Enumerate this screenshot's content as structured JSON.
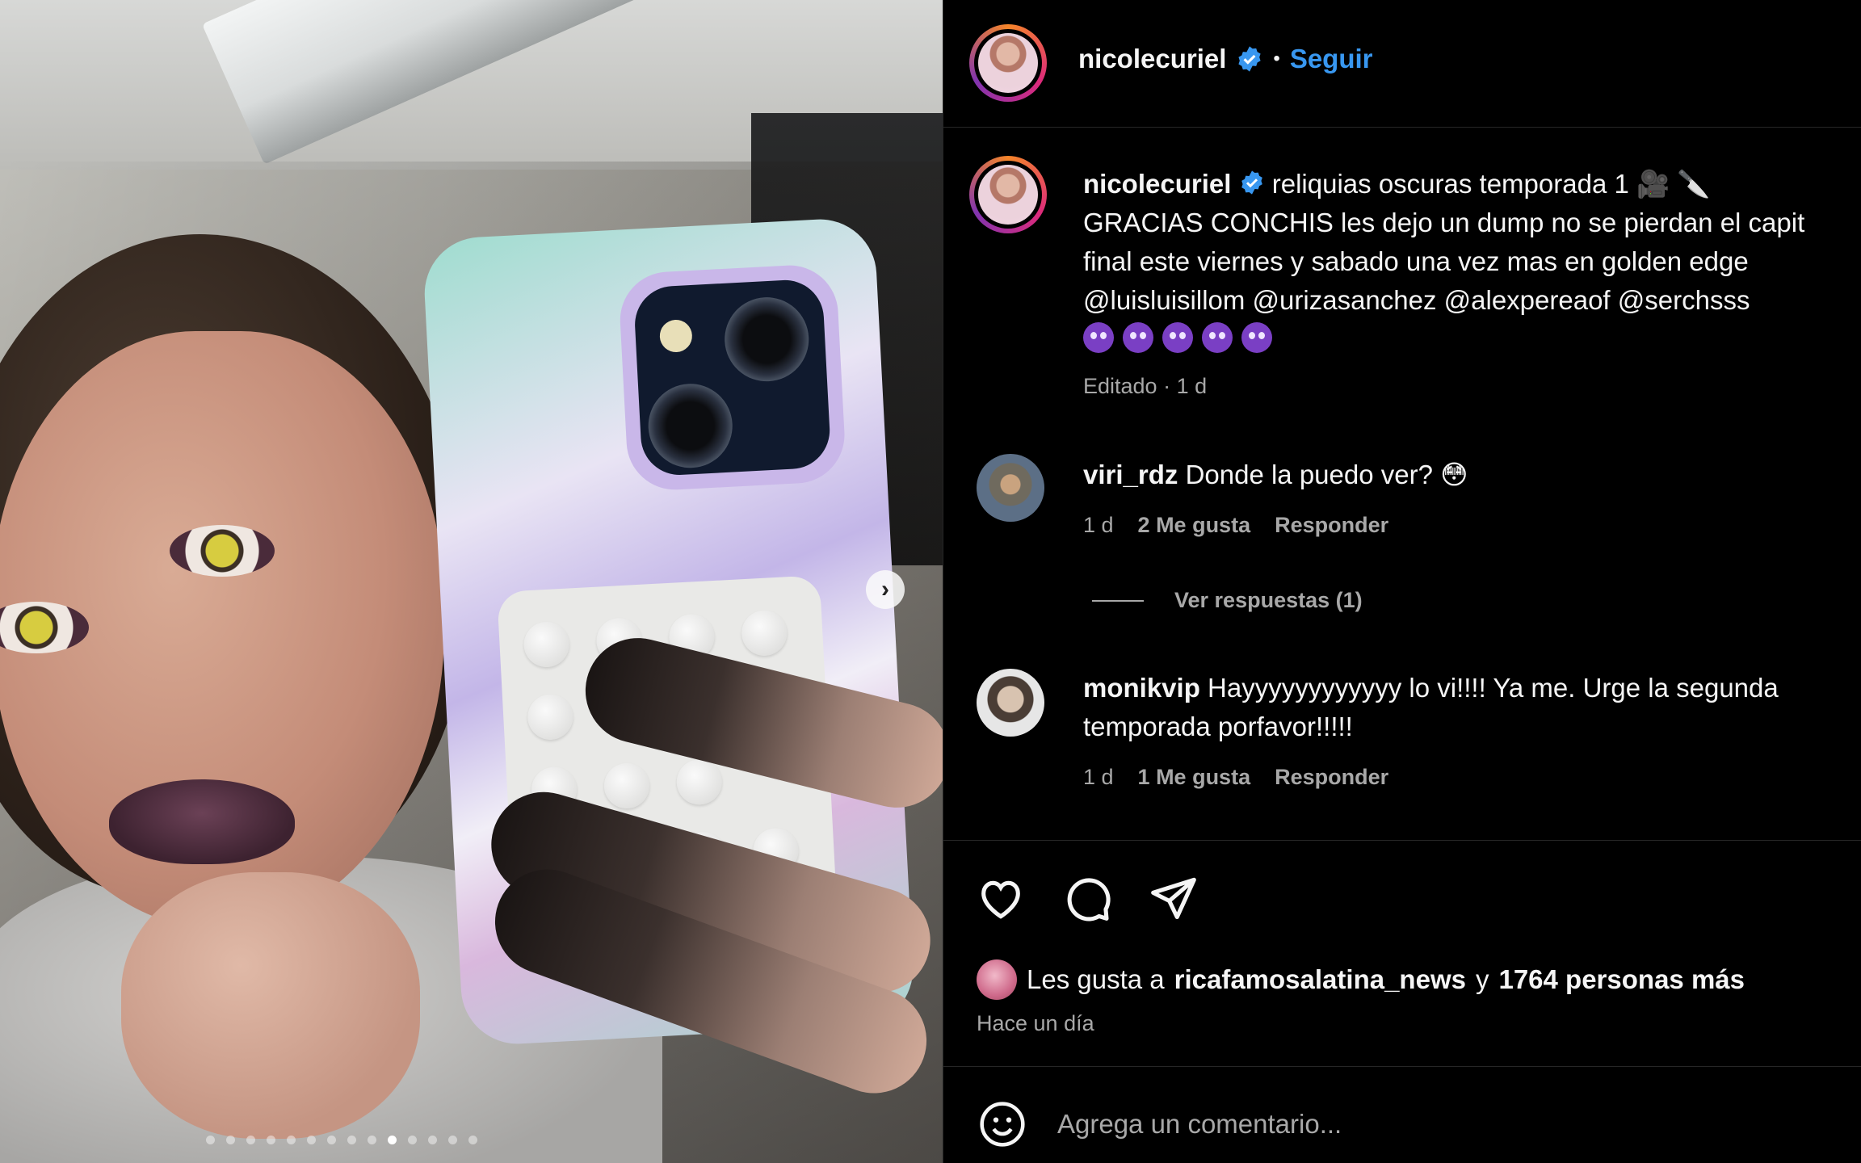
{
  "post": {
    "author": "nicolecuriel",
    "follow_label": "Seguir",
    "dot_separator": "•",
    "caption_lines": [
      "reliquias oscuras temporada 1 🎥 🔪",
      "GRACIAS CONCHIS les dejo un dump no se pierdan el capit",
      "final este viernes y sabado una vez mas en golden edge",
      "@luisluisillom @urizasanchez @alexpereaof @serchsss"
    ],
    "caption_meta": "Editado · 1 d",
    "emoji_count": 5
  },
  "comments": [
    {
      "user": "viri_rdz",
      "text": "Donde la puedo ver? 😳",
      "time": "1 d",
      "likes": "2 Me gusta",
      "reply_label": "Responder",
      "view_replies": "Ver respuestas (1)"
    },
    {
      "user": "monikvip",
      "text_line1": "Hayyyyyyyyyyyy lo vi!!!! Ya me. Urge la segunda",
      "text_line2": "temporada porfavor!!!!!",
      "time": "1 d",
      "likes": "1 Me gusta",
      "reply_label": "Responder"
    }
  ],
  "likes_summary": {
    "prefix": "Les gusta a",
    "user": "ricafamosalatina_news",
    "middle": "y",
    "count_text": "1764 personas más"
  },
  "posted_ago": "Hace un día",
  "add_comment_placeholder": "Agrega un comentario...",
  "carousel": {
    "total": 14,
    "active_index": 9
  },
  "icons": {
    "verified": "verified-badge-icon",
    "like": "heart-icon",
    "comment": "comment-bubble-icon",
    "share": "paper-plane-icon",
    "emoji": "smiley-icon",
    "next": "chevron-right-icon"
  },
  "colors": {
    "accent": "#3897f0",
    "background": "#000000",
    "muted": "#a8a8a8"
  }
}
